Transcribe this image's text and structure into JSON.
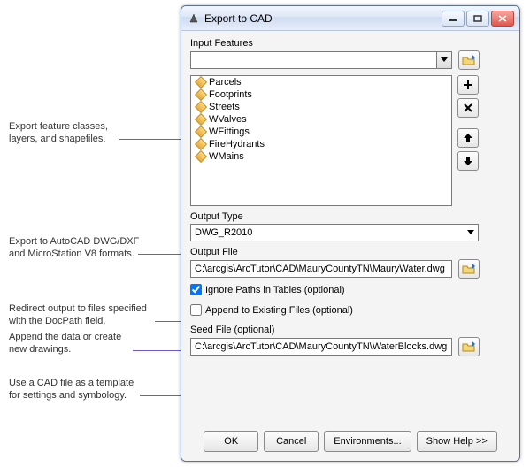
{
  "window": {
    "title": "Export to CAD"
  },
  "labels": {
    "input_features": "Input Features",
    "output_type": "Output Type",
    "output_file": "Output File",
    "ignore_paths": "Ignore Paths in Tables (optional)",
    "append": "Append to Existing Files (optional)",
    "seed_file": "Seed File (optional)"
  },
  "inputs": {
    "features_combo": "",
    "features_list": [
      "Parcels",
      "Footprints",
      "Streets",
      "WValves",
      "WFittings",
      "FireHydrants",
      "WMains"
    ],
    "output_type_value": "DWG_R2010",
    "output_file_value": "C:\\arcgis\\ArcTutor\\CAD\\MauryCountyTN\\MauryWater.dwg",
    "ignore_paths_checked": true,
    "append_checked": false,
    "seed_file_value": "C:\\arcgis\\ArcTutor\\CAD\\MauryCountyTN\\WaterBlocks.dwg"
  },
  "buttons": {
    "ok": "OK",
    "cancel": "Cancel",
    "environments": "Environments...",
    "show_help": "Show Help >>"
  },
  "annotations": {
    "a1_l1": "Export feature classes,",
    "a1_l2": "layers, and shapefiles.",
    "a2_l1": "Export to AutoCAD DWG/DXF",
    "a2_l2": "and MicroStation V8 formats.",
    "a3_l1": "Redirect output to files specified",
    "a3_l2": "with the DocPath field.",
    "a4_l1": "Append the data or create",
    "a4_l2": "new drawings.",
    "a5_l1": "Use a CAD file as a template",
    "a5_l2": "for settings and symbology."
  }
}
